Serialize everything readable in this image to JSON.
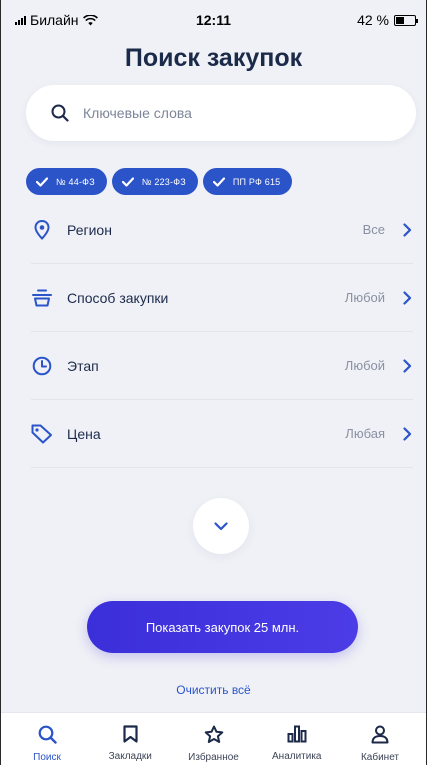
{
  "status_bar": {
    "carrier": "Билайн",
    "time": "12:11",
    "battery": "42 %",
    "battery_level": 0.42
  },
  "header": {
    "title": "Поиск закупок"
  },
  "search": {
    "placeholder": "Ключевые слова",
    "value": ""
  },
  "chips": [
    {
      "label": "№ 44-ФЗ",
      "checked": true
    },
    {
      "label": "№ 223-ФЗ",
      "checked": true
    },
    {
      "label": "ПП РФ 615",
      "checked": true
    }
  ],
  "filters": [
    {
      "label": "Регион",
      "value": "Все",
      "icon": "location-pin-icon"
    },
    {
      "label": "Способ закупки",
      "value": "Любой",
      "icon": "basket-icon"
    },
    {
      "label": "Этап",
      "value": "Любой",
      "icon": "clock-icon"
    },
    {
      "label": "Цена",
      "value": "Любая",
      "icon": "price-tag-icon"
    }
  ],
  "actions": {
    "show_label": "Показать закупок 25 млн.",
    "clear_label": "Очистить всё"
  },
  "tabbar": [
    {
      "label": "Поиск",
      "icon": "search-icon",
      "active": true
    },
    {
      "label": "Закладки",
      "icon": "bookmark-icon",
      "active": false
    },
    {
      "label": "Избранное",
      "icon": "star-icon",
      "active": false
    },
    {
      "label": "Аналитика",
      "icon": "analytics-icon",
      "active": false
    },
    {
      "label": "Кабинет",
      "icon": "user-icon",
      "active": false
    }
  ],
  "colors": {
    "accent": "#2b54c9",
    "button": "#3b2fd9",
    "background": "#eff1f6",
    "text": "#1c2a4a"
  }
}
